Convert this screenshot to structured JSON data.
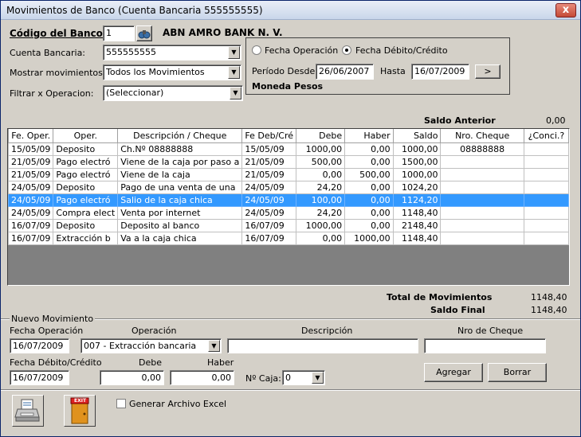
{
  "window": {
    "title": "Movimientos de Banco (Cuenta Bancaria 555555555)",
    "close": "x"
  },
  "header": {
    "codigo_label": "Código del Banco:",
    "codigo_value": "1",
    "bank_name": "ABN AMRO BANK N. V.",
    "cuenta_label": "Cuenta Bancaria:",
    "cuenta_value": "555555555",
    "mostrar_label": "Mostrar movimientos:",
    "mostrar_value": "Todos los Movimientos",
    "filtrar_label": "Filtrar x Operacion:",
    "filtrar_value": "(Seleccionar)"
  },
  "periodo": {
    "radio_operacion": "Fecha Operación",
    "radio_debito": "Fecha Débito/Crédito",
    "desde_label": "Período Desde",
    "desde_value": "26/06/2007",
    "hasta_label": "Hasta",
    "hasta_value": "16/07/2009",
    "go_label": ">",
    "moneda": "Moneda Pesos"
  },
  "saldo_anterior": {
    "label": "Saldo Anterior",
    "value": "0,00"
  },
  "table": {
    "columns": [
      "Fe. Oper.",
      "Oper.",
      "Descripción / Cheque",
      "Fe Deb/Cré",
      "Debe",
      "Haber",
      "Saldo",
      "Nro. Cheque",
      "¿Conci.?"
    ],
    "rows": [
      [
        "15/05/09",
        "Deposito",
        "Ch.Nº 08888888",
        "15/05/09",
        "1000,00",
        "0,00",
        "1000,00",
        "08888888",
        ""
      ],
      [
        "21/05/09",
        "Pago electró",
        "Viene de la caja por paso a",
        "21/05/09",
        "500,00",
        "0,00",
        "1500,00",
        "",
        ""
      ],
      [
        "21/05/09",
        "Pago electró",
        "Viene de la caja",
        "21/05/09",
        "0,00",
        "500,00",
        "1000,00",
        "",
        ""
      ],
      [
        "24/05/09",
        "Deposito",
        "Pago de una venta de una",
        "24/05/09",
        "24,20",
        "0,00",
        "1024,20",
        "",
        ""
      ],
      [
        "24/05/09",
        "Pago electró",
        "Salio de la caja chica",
        "24/05/09",
        "100,00",
        "0,00",
        "1124,20",
        "",
        ""
      ],
      [
        "24/05/09",
        "Compra elect",
        "Venta por internet",
        "24/05/09",
        "24,20",
        "0,00",
        "1148,40",
        "",
        ""
      ],
      [
        "16/07/09",
        "Deposito",
        "Deposito al banco",
        "16/07/09",
        "1000,00",
        "0,00",
        "2148,40",
        "",
        ""
      ],
      [
        "16/07/09",
        "Extracción b",
        "Va a la caja chica",
        "16/07/09",
        "0,00",
        "1000,00",
        "1148,40",
        "",
        ""
      ]
    ],
    "selected_row": 4
  },
  "totals": {
    "total_label": "Total de Movimientos",
    "total_value": "1148,40",
    "final_label": "Saldo Final",
    "final_value": "1148,40"
  },
  "nuevo": {
    "legend": "Nuevo Movimiento",
    "fecha_op_label": "Fecha Operación",
    "fecha_op_value": "16/07/2009",
    "operacion_label": "Operación",
    "operacion_value": "007 - Extracción bancaria",
    "descripcion_label": "Descripción",
    "descripcion_value": "",
    "cheque_label": "Nro de Cheque",
    "cheque_value": "",
    "fecha_deb_label": "Fecha Débito/Crédito",
    "fecha_deb_value": "16/07/2009",
    "debe_label": "Debe",
    "debe_value": "0,00",
    "haber_label": "Haber",
    "haber_value": "0,00",
    "caja_label": "Nº Caja:",
    "caja_value": "0",
    "agregar": "Agregar",
    "borrar": "Borrar"
  },
  "footer": {
    "excel_label": "Generar Archivo Excel",
    "exit_text": "EXIT"
  }
}
